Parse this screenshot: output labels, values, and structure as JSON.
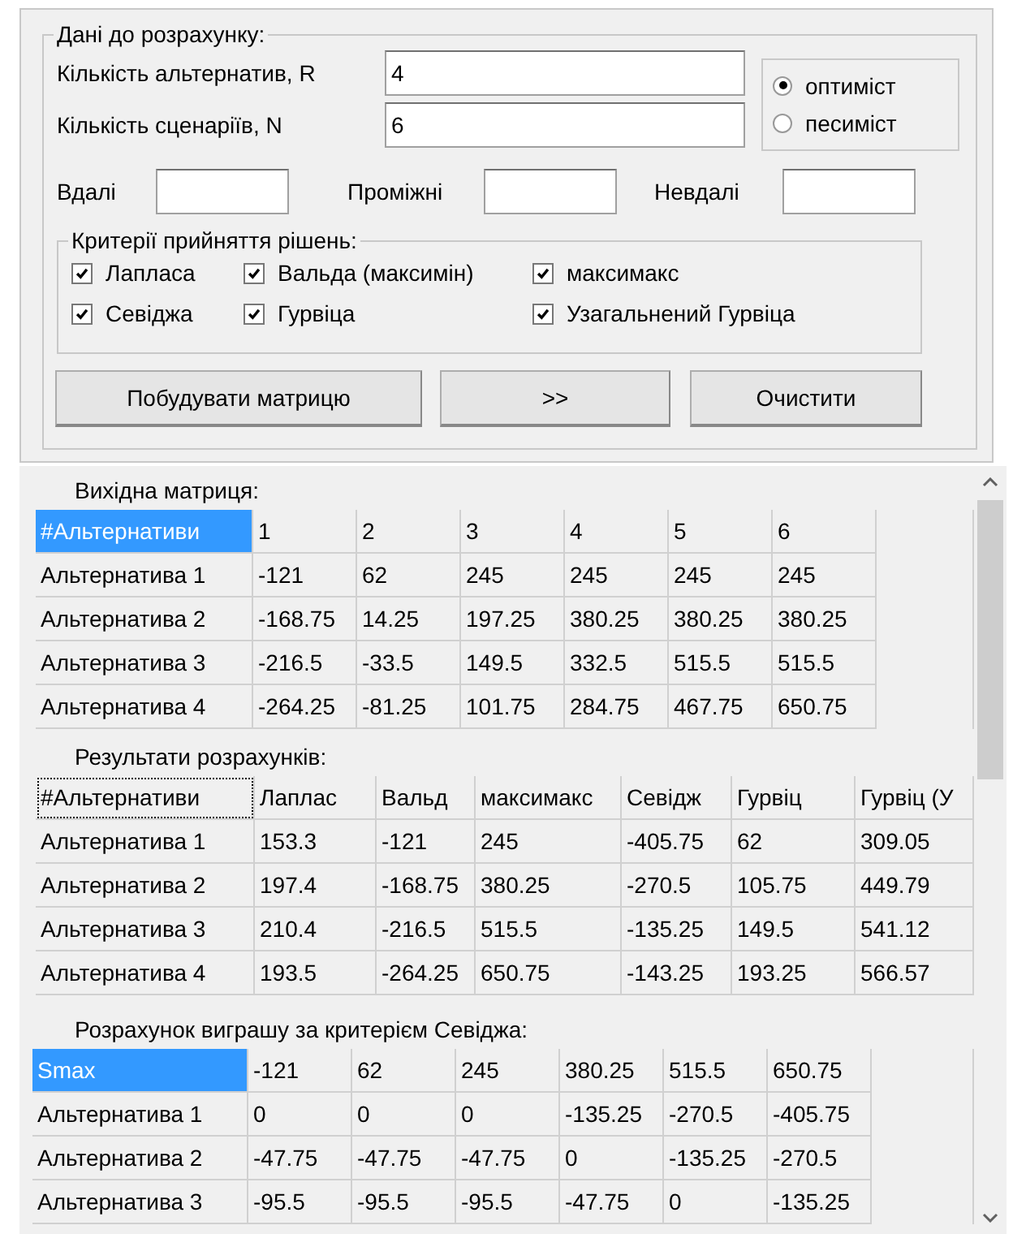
{
  "input_group": {
    "title": "Дані до розрахунку:",
    "fields": [
      {
        "label": "Кількість альтернатив, R",
        "value": "4"
      },
      {
        "label": "Кількість сценаріїв, N",
        "value": "6"
      }
    ],
    "mode": [
      {
        "label": "оптиміст",
        "selected": true
      },
      {
        "label": "песиміст",
        "selected": false
      }
    ],
    "outcomes": [
      {
        "label": "Вдалі"
      },
      {
        "label": "Проміжні"
      },
      {
        "label": "Невдалі"
      }
    ],
    "criteria": {
      "title": "Критерії прийняття рішень:",
      "items": [
        {
          "label": "Лапласа",
          "checked": true
        },
        {
          "label": "Вальда (максимін)",
          "checked": true
        },
        {
          "label": "максимакс",
          "checked": true
        },
        {
          "label": "Севіджа",
          "checked": true
        },
        {
          "label": "Гурвіца",
          "checked": true
        },
        {
          "label": "Узагальнений Гурвіца",
          "checked": true
        }
      ]
    },
    "buttons": [
      "Побудувати матрицю",
      ">>",
      "Очистити"
    ]
  },
  "tables": [
    {
      "title": "Вихідна матриця:",
      "corner": {
        "text": "#Альтернативи",
        "selected": true,
        "focused": false
      },
      "columns": [
        "1",
        "2",
        "3",
        "4",
        "5",
        "6"
      ],
      "rows": [
        {
          "label": "Альтернатива 1",
          "cells": [
            "-121",
            "62",
            "245",
            "245",
            "245",
            "245"
          ]
        },
        {
          "label": "Альтернатива 2",
          "cells": [
            "-168.75",
            "14.25",
            "197.25",
            "380.25",
            "380.25",
            "380.25"
          ]
        },
        {
          "label": "Альтернатива 3",
          "cells": [
            "-216.5",
            "-33.5",
            "149.5",
            "332.5",
            "515.5",
            "515.5"
          ]
        },
        {
          "label": "Альтернатива 4",
          "cells": [
            "-264.25",
            "-81.25",
            "101.75",
            "284.75",
            "467.75",
            "650.75"
          ]
        }
      ]
    },
    {
      "title": "Результати розрахунків:",
      "corner": {
        "text": "#Альтернативи",
        "selected": false,
        "focused": true
      },
      "columns": [
        "Лаплас",
        "Вальд",
        "максимакс",
        "Севідж",
        "Гурвіц",
        "Гурвіц (У"
      ],
      "rows": [
        {
          "label": "Альтернатива 1",
          "cells": [
            "153.3",
            "-121",
            "245",
            "-405.75",
            "62",
            "309.05"
          ]
        },
        {
          "label": "Альтернатива 2",
          "cells": [
            "197.4",
            "-168.75",
            "380.25",
            "-270.5",
            "105.75",
            "449.79"
          ]
        },
        {
          "label": "Альтернатива 3",
          "cells": [
            "210.4",
            "-216.5",
            "515.5",
            "-135.25",
            "149.5",
            "541.12"
          ]
        },
        {
          "label": "Альтернатива 4",
          "cells": [
            "193.5",
            "-264.25",
            "650.75",
            "-143.25",
            "193.25",
            "566.57"
          ]
        }
      ]
    },
    {
      "title": "Розрахунок виграшу за критерієм Севіджа:",
      "corner": {
        "text": "Smax",
        "selected": true,
        "focused": false
      },
      "columns": [
        "-121",
        "62",
        "245",
        "380.25",
        "515.5",
        "650.75"
      ],
      "rows": [
        {
          "label": "Альтернатива 1",
          "cells": [
            "0",
            "0",
            "0",
            "-135.25",
            "-270.5",
            "-405.75"
          ]
        },
        {
          "label": "Альтернатива 2",
          "cells": [
            "-47.75",
            "-47.75",
            "-47.75",
            "0",
            "-135.25",
            "-270.5"
          ]
        },
        {
          "label": "Альтернатива 3",
          "cells": [
            "-95.5",
            "-95.5",
            "-95.5",
            "-47.75",
            "0",
            "-135.25"
          ]
        }
      ]
    }
  ]
}
